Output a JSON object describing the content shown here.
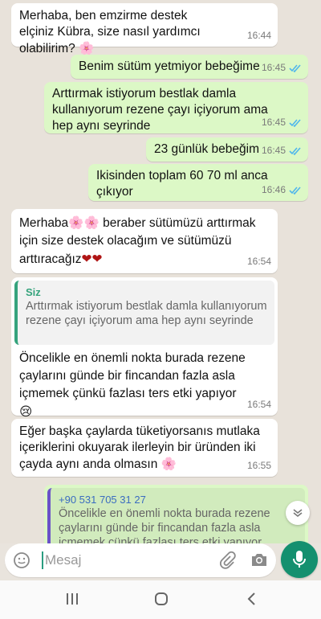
{
  "messages": [
    {
      "text": "Merhaba, ben emzirme destek elçiniz Kübra, size nasıl yardımcı olabilirim?",
      "emoji": "🌸",
      "time": "16:44"
    },
    {
      "text": "Benim sütüm yetmiyor bebeğime",
      "time": "16:45"
    },
    {
      "text": "Arttırmak istiyorum bestlak damla kullanıyorum rezene çayı içiyorum ama hep aynı seyrinde",
      "time": "16:45"
    },
    {
      "text": "23 günlük bebeğim",
      "time": "16:45"
    },
    {
      "text": "Ikisinden toplam 60 70 ml anca çıkıyor",
      "time": "16:46"
    },
    {
      "text_a": "Merhaba",
      "emoji_a": "🌸🌸",
      "text_b": " beraber sütümüzü arttırmak için size destek olacağım ve sütümüzü arttıracağız",
      "emoji_b": "❤❤",
      "time": "16:54"
    },
    {
      "quote_name": "Siz",
      "quote_text": "Arttırmak istiyorum bestlak damla kullanıyorum rezene çayı içiyorum ama hep aynı seyrinde",
      "text": "Öncelikle en önemli nokta burada rezene çaylarını günde bir fincandan fazla asla içmemek çünkü fazlası ters etki yapıyor",
      "emoji": "😢",
      "time": "16:54"
    },
    {
      "text": "Eğer başka çaylarda tüketiyorsanıs mutlaka içeriklerini okuyarak ilerleyin bir üründen iki çayda aynı anda olmasın",
      "emoji": "🌸",
      "time": "16:55"
    },
    {
      "quote_name": "+90 531 705 31 27",
      "quote_text": "Öncelikle en önemli nokta burada rezene çaylarını günde bir fincandan fazla asla içmemek çünkü fazlası ters etki yapıyor"
    }
  ],
  "composer": {
    "placeholder": "Mesaj"
  },
  "colors": {
    "incoming": "#ffffff",
    "outgoing": "#dcf8c6",
    "accent": "#14906f",
    "read_ticks": "#4fb6ec"
  }
}
